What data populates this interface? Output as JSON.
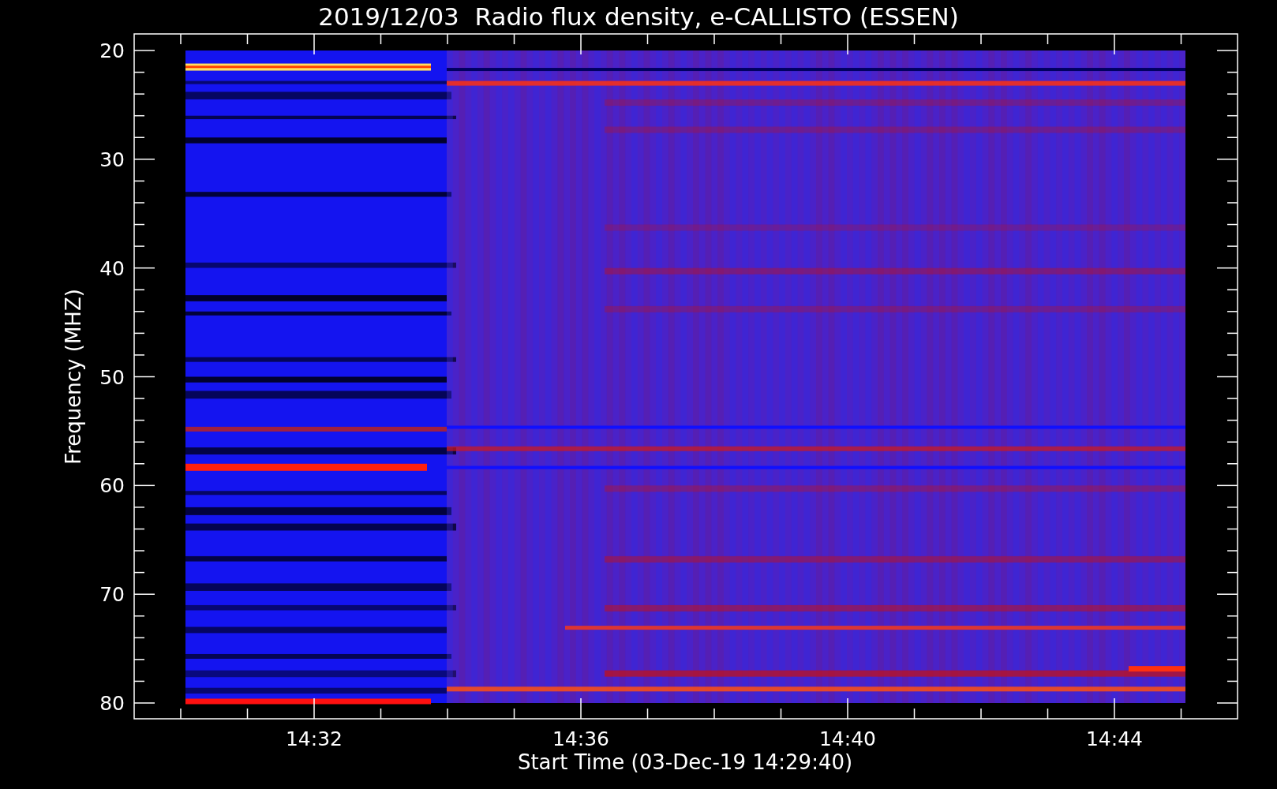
{
  "title": "2019/12/03  Radio flux density, e-CALLISTO (ESSEN)",
  "ylabel": "Frequency (MHZ)",
  "xlabel": "Start Time (03-Dec-19 14:29:40)",
  "yticks": [
    "20",
    "30",
    "40",
    "50",
    "60",
    "70",
    "80"
  ],
  "xticks": [
    "14:32",
    "14:36",
    "14:40",
    "14:44"
  ]
}
